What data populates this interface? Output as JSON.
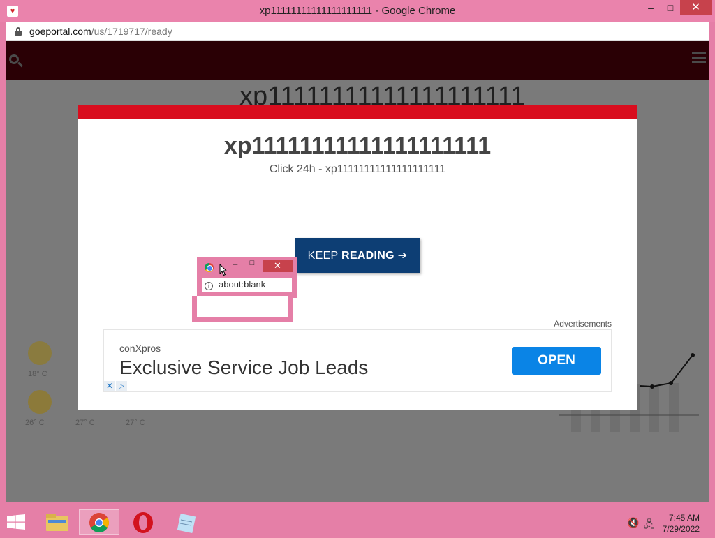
{
  "window": {
    "title": "xp11111111111111111111 - Google Chrome",
    "minimize": "–",
    "maximize": "□",
    "close": "✕"
  },
  "address": {
    "host": "goeportal.com",
    "path": "/us/1719717/ready"
  },
  "background": {
    "title": "xp11111111111111111111",
    "weather": [
      {
        "temp": "18°",
        "unit": "C"
      },
      {
        "temp": "26°",
        "unit": "C"
      },
      {
        "temp": "27°",
        "unit": "C"
      },
      {
        "temp": "27°",
        "unit": "C"
      }
    ]
  },
  "modal": {
    "title": "xp11111111111111111111",
    "subtitle": "Click 24h - xp11111111111111111111",
    "button_text": "KEEP",
    "button_bold": "READING",
    "button_arrow": "➔",
    "ads_label": "Advertisements",
    "accent": "#d90d1e",
    "button_color": "#0d3e74"
  },
  "ad": {
    "brand": "conXpros",
    "headline": "Exclusive Service Job Leads",
    "cta": "OPEN",
    "close_icon": "✕",
    "choices_icon": "▷"
  },
  "popup": {
    "address": "about:blank",
    "close": "✕",
    "maximize": "□",
    "minimize": "–"
  },
  "taskbar": {
    "time": "7:45 AM",
    "date": "7/29/2022",
    "apps": [
      "file-explorer",
      "google-chrome",
      "opera",
      "notepad"
    ]
  }
}
